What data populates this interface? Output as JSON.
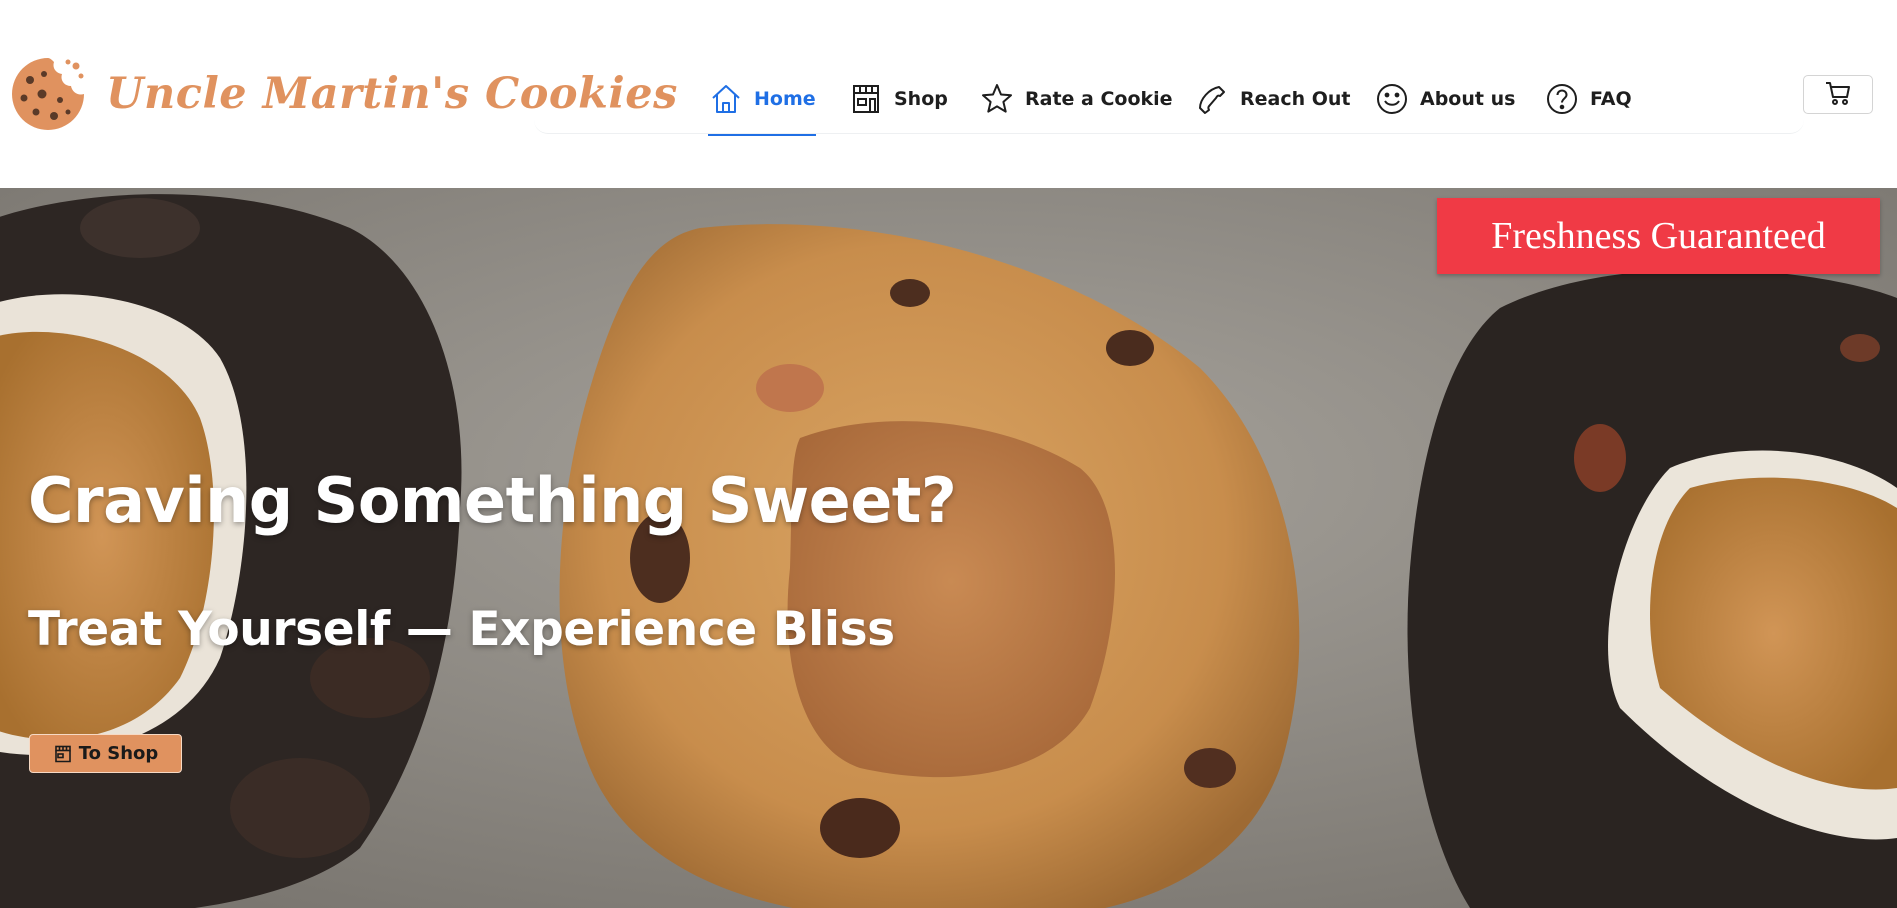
{
  "brand": {
    "name": "Uncle Martin's Cookies",
    "logo_icon": "cookie-icon",
    "color": "#e0925f"
  },
  "nav": {
    "accent_color": "#1f6fe5",
    "items": [
      {
        "label": "Home",
        "icon": "home-icon",
        "active": true
      },
      {
        "label": "Shop",
        "icon": "store-icon",
        "active": false
      },
      {
        "label": "Rate a Cookie",
        "icon": "star-icon",
        "active": false
      },
      {
        "label": "Reach Out",
        "icon": "phone-icon",
        "active": false
      },
      {
        "label": "About us",
        "icon": "smiley-icon",
        "active": false
      },
      {
        "label": "FAQ",
        "icon": "question-icon",
        "active": false
      }
    ],
    "cart_icon": "cart-icon"
  },
  "hero": {
    "badge": "Freshness Guaranteed",
    "badge_color": "#f03a45",
    "title": "Craving Something Sweet?",
    "subtitle": "Treat Yourself — Experience Bliss",
    "cta_label": "To Shop",
    "cta_icon": "store-icon",
    "cta_color": "#e0925f"
  }
}
